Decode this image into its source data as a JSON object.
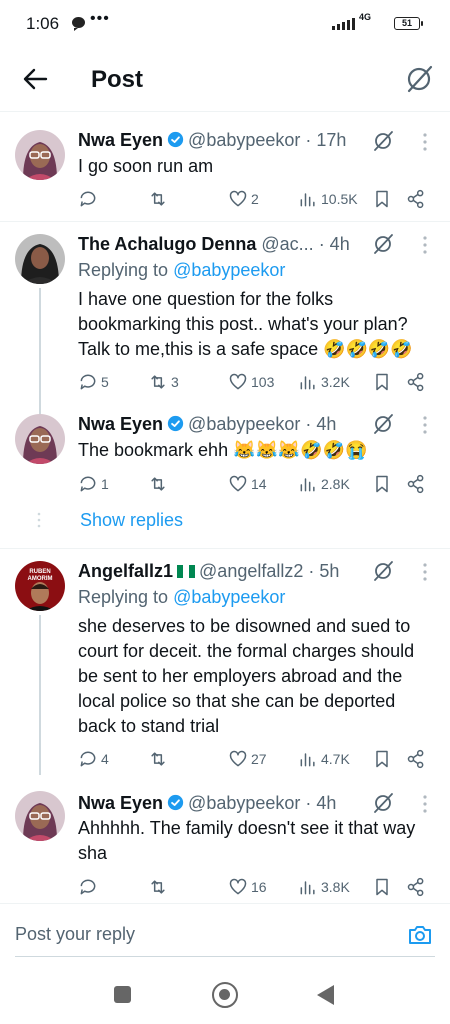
{
  "status_bar": {
    "time": "1:06",
    "dots": "•••",
    "network": "4G",
    "battery": "51"
  },
  "header": {
    "title": "Post"
  },
  "tweets": [
    {
      "name": "Nwa Eyen",
      "handle": "@babypeekor",
      "time": "· 17h",
      "replying_to_label": "",
      "replying_to": "",
      "text": "I go soon run am",
      "replies": "",
      "retweets": "",
      "likes": "2",
      "views": "10.5K"
    },
    {
      "name": "The Achalugo Denna",
      "handle": "@ac...",
      "time": "· 4h",
      "replying_to_label": "Replying to ",
      "replying_to": "@babypeekor",
      "text": "I have one question for the folks bookmarking this post.. what's your plan? Talk to me,this is a safe space 🤣🤣🤣🤣",
      "replies": "5",
      "retweets": "3",
      "likes": "103",
      "views": "3.2K"
    },
    {
      "name": "Nwa Eyen",
      "handle": "@babypeekor",
      "time": "· 4h",
      "replying_to_label": "",
      "replying_to": "",
      "text": "The bookmark ehh 😹😹😹🤣🤣😭",
      "replies": "1",
      "retweets": "",
      "likes": "14",
      "views": "2.8K"
    },
    {
      "name": "Angelfallz1",
      "handle": "@angelfallz2",
      "time": "· 5h",
      "replying_to_label": "Replying to ",
      "replying_to": "@babypeekor",
      "avatar_text_top": "RUBEN",
      "avatar_text_bottom": "AMORIM",
      "text": "she deserves to be disowned and sued to court for deceit. the formal charges should be sent to her employers abroad and the local police so that she can be deported back to stand trial",
      "replies": "4",
      "retweets": "",
      "likes": "27",
      "views": "4.7K"
    },
    {
      "name": "Nwa Eyen",
      "handle": "@babypeekor",
      "time": "· 4h",
      "replying_to_label": "",
      "replying_to": "",
      "text": "Ahhhhh. The family doesn't see it that way sha",
      "replies": "",
      "retweets": "",
      "likes": "16",
      "views": "3.8K"
    }
  ],
  "show_replies": "Show replies",
  "reply_bar": {
    "placeholder": "Post your reply"
  },
  "colors": {
    "accent": "#1d9bf0",
    "text": "#0f1419",
    "muted": "#536471",
    "border": "#eff3f4"
  }
}
